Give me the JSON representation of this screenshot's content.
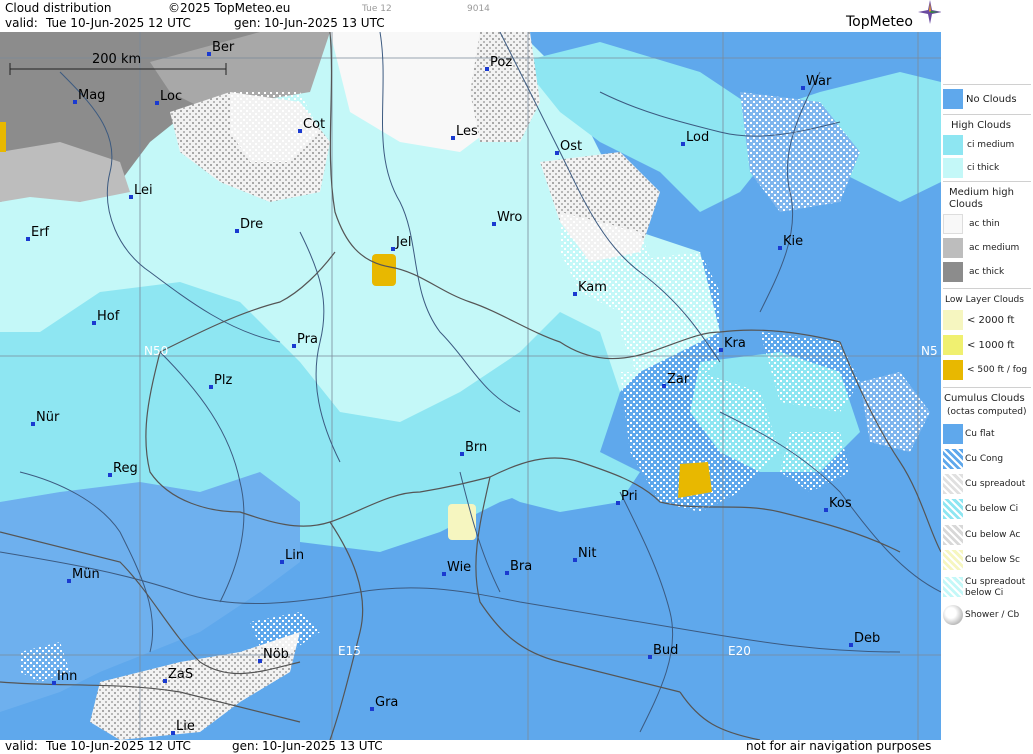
{
  "header": {
    "title": "Cloud distribution",
    "copyright": "©2025 TopMeteo.eu",
    "valid_label": "valid:",
    "valid_value": "Tue  10-Jun-2025  12 UTC",
    "gen_label": "gen:",
    "gen_value": "10-Jun-2025 13 UTC",
    "faint_day": "Tue 12",
    "faint_code": "9014",
    "brand": "TopMeteo"
  },
  "footer": {
    "valid_label": "valid:",
    "valid_value": "Tue  10-Jun-2025  12 UTC",
    "gen_label": "gen:",
    "gen_value": "10-Jun-2025 13 UTC",
    "disclaimer": "not for air navigation purposes"
  },
  "map": {
    "scale_label": "200 km",
    "grid_labels": {
      "n50": "N50",
      "n50_right": "N5",
      "e15": "E15",
      "e20": "E20"
    },
    "cities": [
      {
        "name": "Ber",
        "key": "ber"
      },
      {
        "name": "Poz",
        "key": "poz"
      },
      {
        "name": "War",
        "key": "war"
      },
      {
        "name": "Mag",
        "key": "mag"
      },
      {
        "name": "Loc",
        "key": "loc"
      },
      {
        "name": "Cot",
        "key": "cot"
      },
      {
        "name": "Les",
        "key": "les"
      },
      {
        "name": "Ost",
        "key": "ost"
      },
      {
        "name": "Lod",
        "key": "lod"
      },
      {
        "name": "Lei",
        "key": "lei"
      },
      {
        "name": "Dre",
        "key": "dre"
      },
      {
        "name": "Wro",
        "key": "wro"
      },
      {
        "name": "Erf",
        "key": "erf"
      },
      {
        "name": "Jel",
        "key": "jel"
      },
      {
        "name": "Kie",
        "key": "kie"
      },
      {
        "name": "Kam",
        "key": "kam"
      },
      {
        "name": "Hof",
        "key": "hof"
      },
      {
        "name": "Pra",
        "key": "pra"
      },
      {
        "name": "Kra",
        "key": "kra"
      },
      {
        "name": "Zar",
        "key": "zar"
      },
      {
        "name": "Plz",
        "key": "plz"
      },
      {
        "name": "Nür",
        "key": "nur"
      },
      {
        "name": "Brn",
        "key": "brn"
      },
      {
        "name": "Reg",
        "key": "reg"
      },
      {
        "name": "Pri",
        "key": "pri"
      },
      {
        "name": "Kos",
        "key": "kos"
      },
      {
        "name": "Lin",
        "key": "lin"
      },
      {
        "name": "Nit",
        "key": "nit"
      },
      {
        "name": "Wie",
        "key": "wie"
      },
      {
        "name": "Bra",
        "key": "bra"
      },
      {
        "name": "Mün",
        "key": "mun"
      },
      {
        "name": "Deb",
        "key": "deb"
      },
      {
        "name": "Inn",
        "key": "inn"
      },
      {
        "name": "ZaS",
        "key": "zas"
      },
      {
        "name": "Nöb",
        "key": "nob"
      },
      {
        "name": "Bud",
        "key": "bud"
      },
      {
        "name": "Gra",
        "key": "gra"
      },
      {
        "name": "Lie",
        "key": "lie"
      }
    ]
  },
  "legend": {
    "no_clouds": "No Clouds",
    "high_clouds": "High Clouds",
    "ci_medium": "ci medium",
    "ci_thick": "ci thick",
    "medium_high_1": "Medium high",
    "medium_high_2": "Clouds",
    "ac_thin": "ac thin",
    "ac_medium": "ac medium",
    "ac_thick": "ac thick",
    "low_layer": "Low Layer Clouds",
    "lt2000": "< 2000 ft",
    "lt1000": "< 1000 ft",
    "lt500": "< 500 ft / fog",
    "cumulus_1": "Cumulus Clouds",
    "cumulus_2": "(octas computed)",
    "cu_flat": "Cu flat",
    "cu_cong": "Cu Cong",
    "cu_spreadout": "Cu spreadout",
    "cu_below_ci": "Cu below Ci",
    "cu_below_ac": "Cu below Ac",
    "cu_below_sc": "Cu below Sc",
    "cu_spread_ci_1": "Cu spreadout",
    "cu_spread_ci_2": "below Ci",
    "shower_cb": "Shower / Cb"
  },
  "colors": {
    "no_clouds": "#5fa8ec",
    "ci_medium": "#8ee6f2",
    "ci_thick": "#c4f8f8",
    "ac_thin": "#f8f8f8",
    "ac_medium": "#bdbdbd",
    "ac_thick": "#8c8c8c",
    "low_2000": "#f6f6c0",
    "low_1000": "#f0f070",
    "low_500": "#e8b800",
    "river": "#3c5a80",
    "border": "#5a5a5a",
    "grid": "#7a8a9a"
  }
}
